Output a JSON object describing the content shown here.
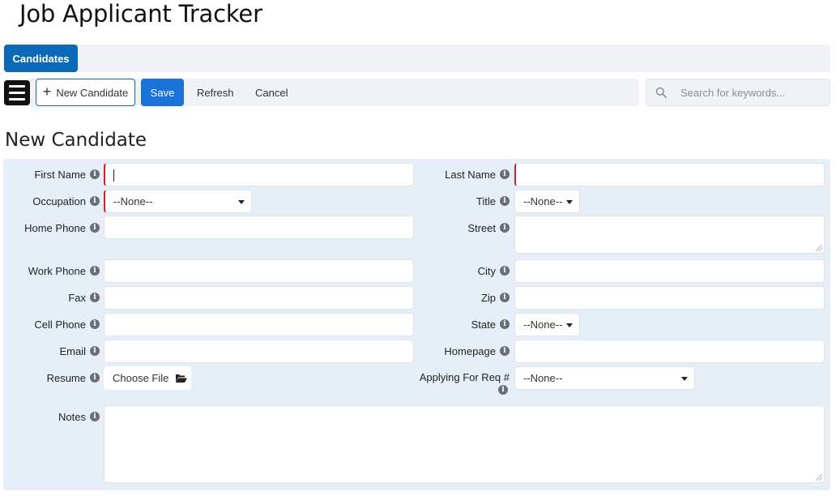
{
  "app": {
    "title": "Job Applicant Tracker"
  },
  "tabs": [
    {
      "label": "Candidates",
      "active": true
    }
  ],
  "toolbar": {
    "menu_icon": "hamburger-menu-icon",
    "new_label": "New Candidate",
    "save_label": "Save",
    "refresh_label": "Refresh",
    "cancel_label": "Cancel"
  },
  "search": {
    "placeholder": "Search for keywords...",
    "value": ""
  },
  "form": {
    "heading": "New Candidate",
    "labels": {
      "first_name": "First Name",
      "last_name": "Last Name",
      "occupation": "Occupation",
      "title": "Title",
      "home_phone": "Home Phone",
      "street": "Street",
      "work_phone": "Work Phone",
      "city": "City",
      "fax": "Fax",
      "zip": "Zip",
      "cell_phone": "Cell Phone",
      "state": "State",
      "email": "Email",
      "homepage": "Homepage",
      "resume": "Resume",
      "applying_for": "Applying For Req #",
      "notes": "Notes"
    },
    "values": {
      "occupation": "--None--",
      "title": "--None--",
      "state": "--None--",
      "applying_for": "--None--"
    },
    "resume_button": "Choose File",
    "info_glyph": "i"
  },
  "colors": {
    "accent": "#0b69b7",
    "save_button": "#1a73d9",
    "required_marker": "#c0282d",
    "form_background": "#e6eef7"
  }
}
